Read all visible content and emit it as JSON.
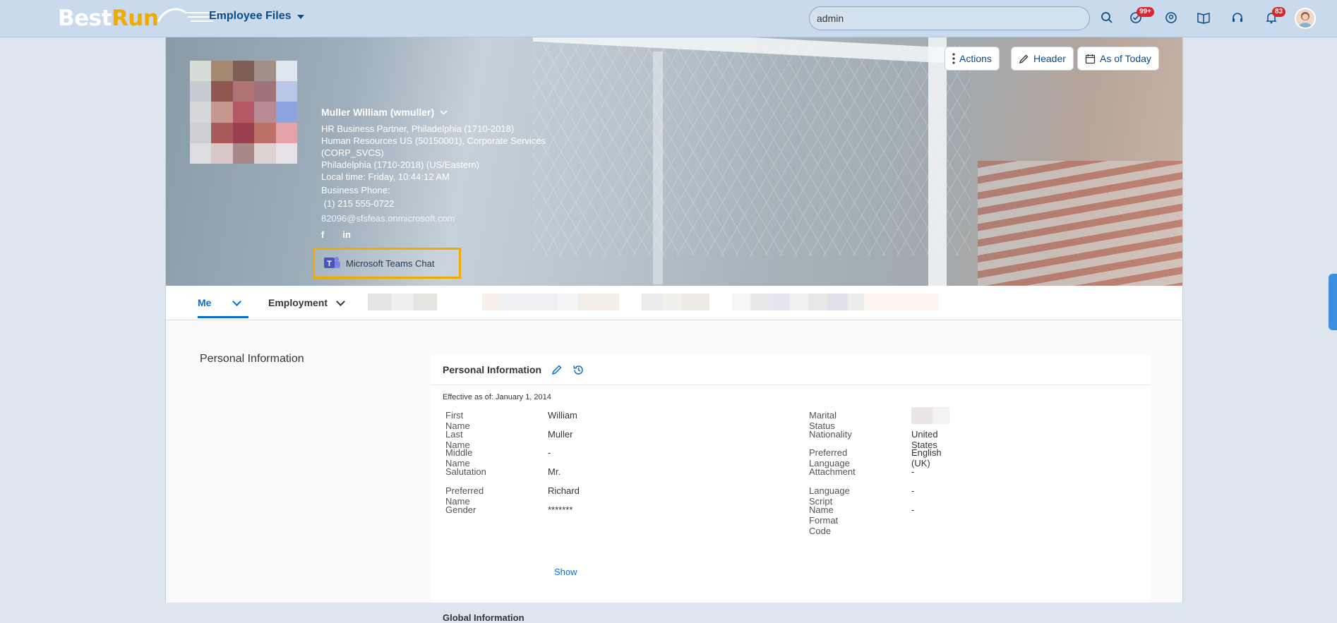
{
  "shell": {
    "logo_best": "Best",
    "logo_run": "Run",
    "app_title": "Employee Files",
    "search_value": "admin",
    "tasks_badge": "99+",
    "notif_badge": "83"
  },
  "header_actions": {
    "actions": "Actions",
    "header": "Header",
    "as_of": "As of Today"
  },
  "employee": {
    "name": "Muller William (wmuller)",
    "position": "HR Business Partner, Philadelphia (1710-2018)",
    "department": "Human Resources US (50150001), Corporate Services",
    "division": "(CORP_SVCS)",
    "location": "Philadelphia (1710-2018) (US/Eastern)",
    "local_time": "Local time: Friday, 10:44:12 AM",
    "phone_label": "Business Phone:",
    "phone": " (1) 215 555-0722",
    "email": "82096@sfsfeas.onmicrosoft.com",
    "social_f": "f",
    "social_in": "in",
    "teams_chat": "Microsoft Teams Chat"
  },
  "tabs": {
    "me": "Me",
    "employment": "Employment"
  },
  "section_nav": "Personal Information",
  "personal_info": {
    "title": "Personal Information",
    "effective": "Effective as of: January 1, 2014",
    "left": [
      {
        "label": "First Name",
        "value": "William"
      },
      {
        "label": "Last Name",
        "value": "Muller"
      },
      {
        "label": "Middle Name",
        "value": "-"
      },
      {
        "label": "Salutation",
        "value": "Mr."
      },
      {
        "label": "Preferred Name",
        "value": "Richard"
      },
      {
        "label": "Gender",
        "value": "*******"
      }
    ],
    "right": [
      {
        "label": "Marital Status",
        "value": ""
      },
      {
        "label": "Nationality",
        "value": "United States"
      },
      {
        "label": "Preferred Language",
        "value": "English (UK)"
      },
      {
        "label": "Attachment",
        "value": "-"
      },
      {
        "label": "Language Script",
        "value": "-"
      },
      {
        "label": "Name Format Code",
        "value": "-"
      }
    ],
    "show": "Show",
    "global": "Global Information"
  }
}
